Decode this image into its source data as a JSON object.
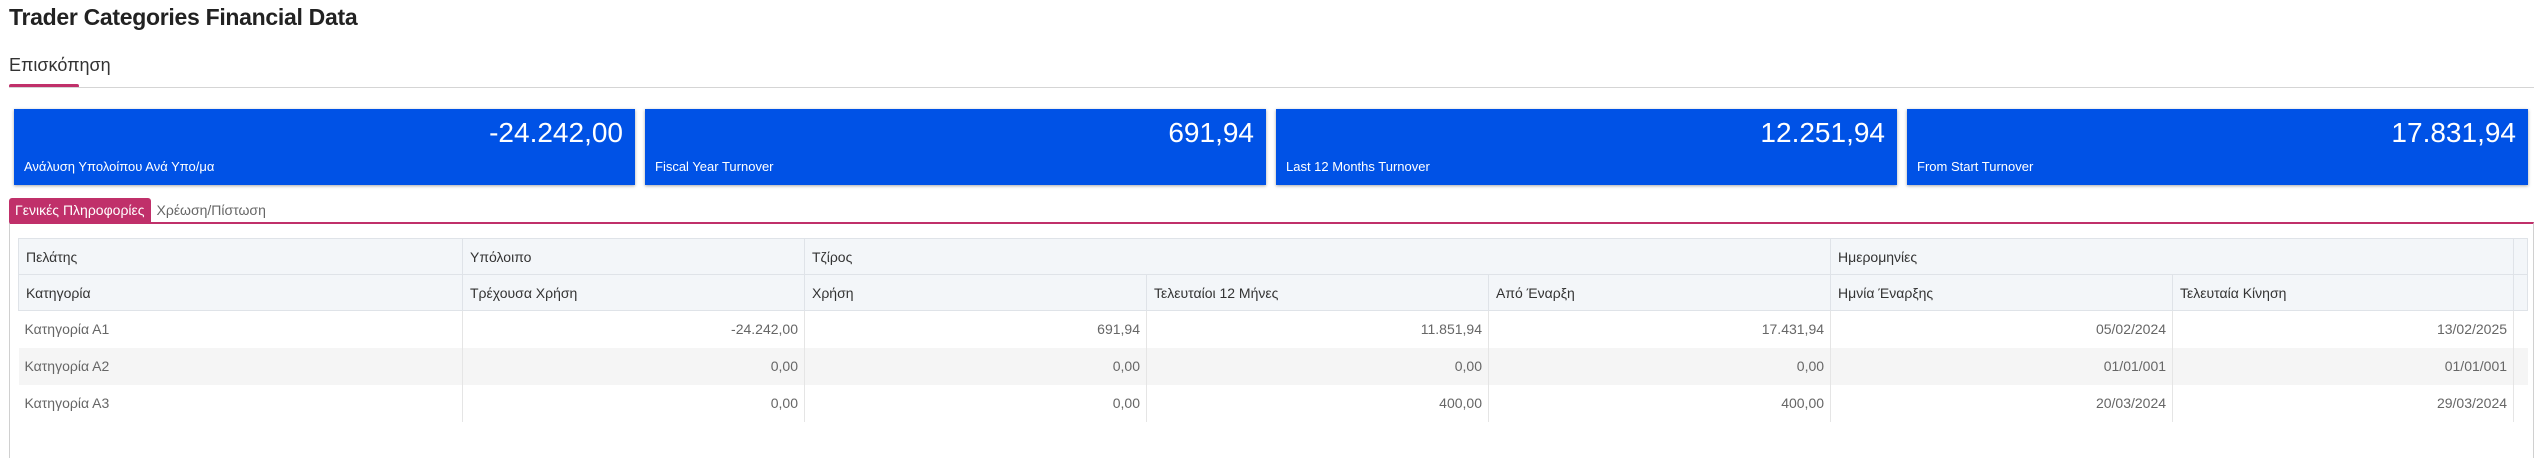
{
  "page": {
    "title": "Trader Categories Financial Data",
    "overview_tab": "Επισκόπηση"
  },
  "kpis": [
    {
      "value": "-24.242,00",
      "label": "Ανάλυση Υπολοίπου Ανά Υπο/μα"
    },
    {
      "value": "691,94",
      "label": "Fiscal Year Turnover"
    },
    {
      "value": "12.251,94",
      "label": "Last 12 Months Turnover"
    },
    {
      "value": "17.831,94",
      "label": "From Start Turnover"
    }
  ],
  "tabs": [
    {
      "label": "Γενικές Πληροφορίες",
      "active": true
    },
    {
      "label": "Χρέωση/Πίστωση",
      "active": false
    }
  ],
  "grid": {
    "groups": [
      "Πελάτης",
      "Υπόλοιπο",
      "Τζίρος",
      "Ημερομηνίες"
    ],
    "columns": [
      "Κατηγορία",
      "Τρέχουσα Χρήση",
      "Χρήση",
      "Τελευταίοι 12 Μήνες",
      "Από Έναρξη",
      "Ημνία Έναρξης",
      "Τελευταία Κίνηση"
    ],
    "rows": [
      {
        "category": "Κατηγορία Α1",
        "current_balance": "-24.242,00",
        "fiscal_turnover": "691,94",
        "last12": "11.851,94",
        "from_start": "17.431,94",
        "start_date": "05/02/2024",
        "last_move": "13/02/2025"
      },
      {
        "category": "Κατηγορία Α2",
        "current_balance": "0,00",
        "fiscal_turnover": "0,00",
        "last12": "0,00",
        "from_start": "0,00",
        "start_date": "01/01/001",
        "last_move": "01/01/001"
      },
      {
        "category": "Κατηγορία Α3",
        "current_balance": "0,00",
        "fiscal_turnover": "0,00",
        "last12": "400,00",
        "from_start": "400,00",
        "start_date": "20/03/2024",
        "last_move": "29/03/2024"
      }
    ]
  },
  "colors": {
    "accent": "#c0306a",
    "kpi_background": "#0052e6"
  }
}
